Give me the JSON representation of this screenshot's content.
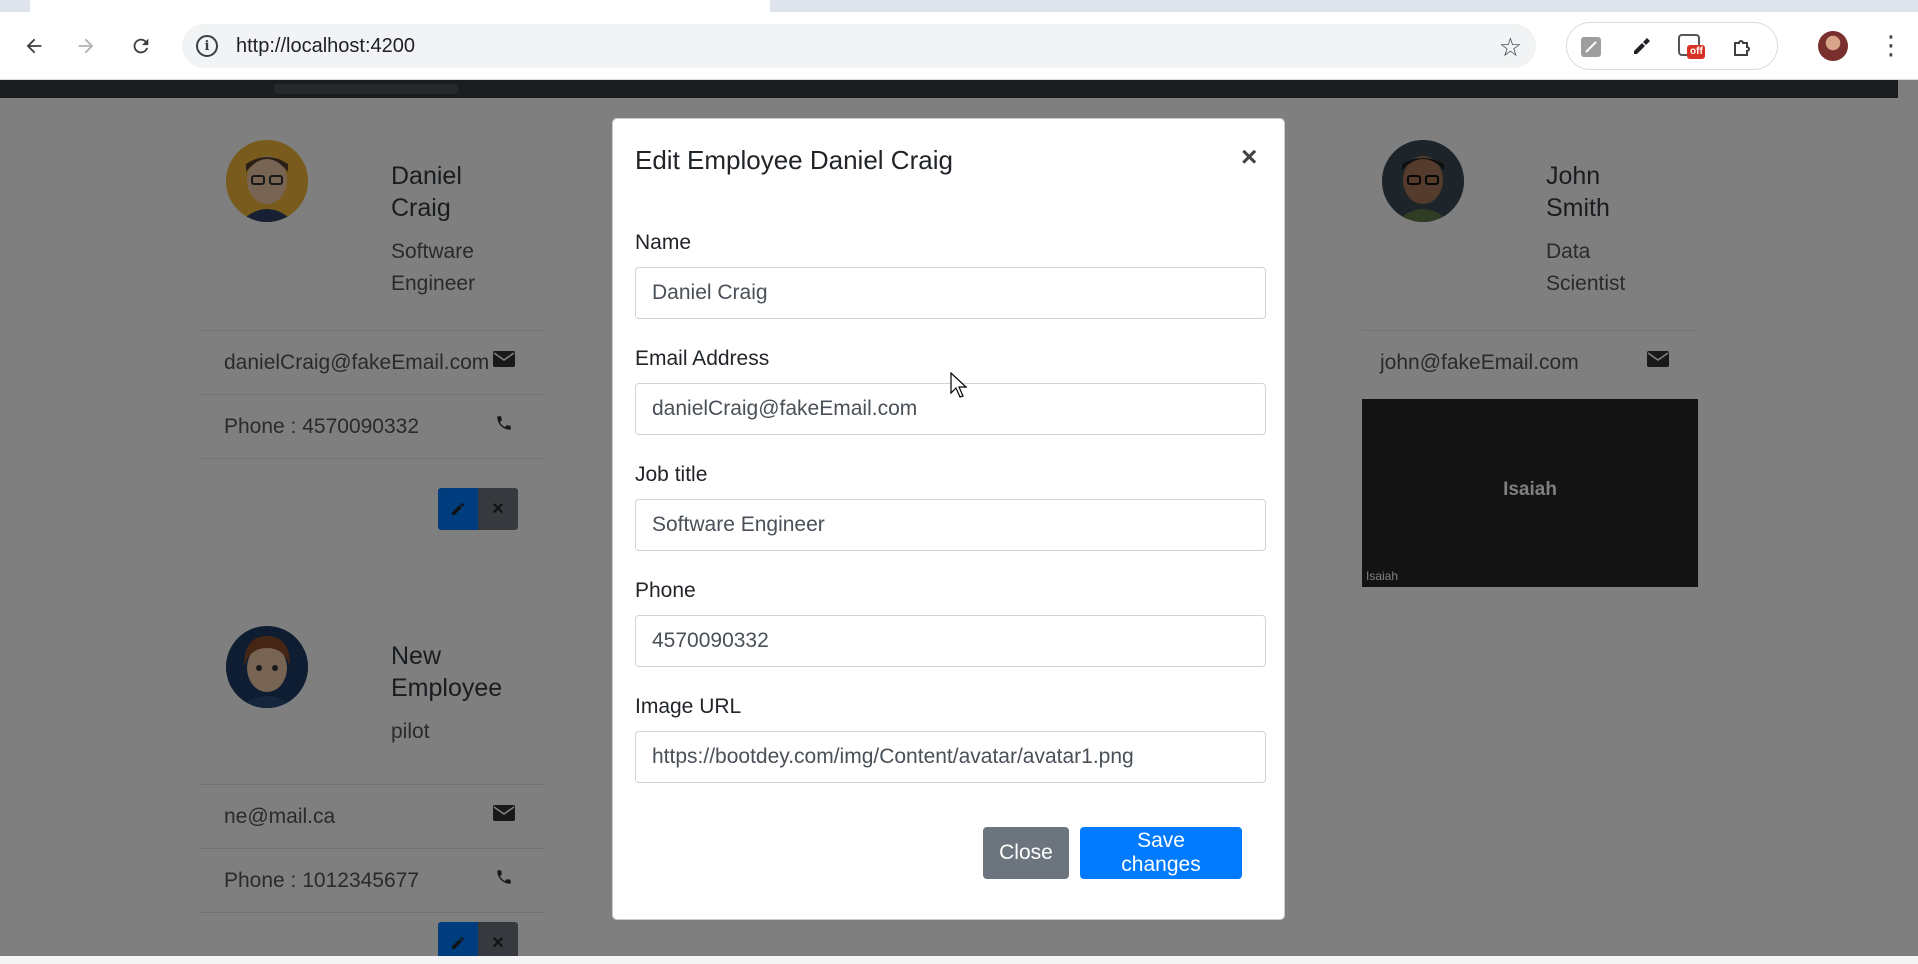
{
  "browser": {
    "url": "http://localhost:4200",
    "ext_badge": "off"
  },
  "employees": [
    {
      "name_line1": "Daniel",
      "name_line2": "Craig",
      "title_line1": "Software",
      "title_line2": "Engineer",
      "email": "danielCraig@fakeEmail.com",
      "phone": "Phone : 4570090332"
    },
    {
      "name_line1": "John",
      "name_line2": "Smith",
      "title_line1": "Data",
      "title_line2": "Scientist",
      "email": "john@fakeEmail.com"
    },
    {
      "name_line1": "New",
      "name_line2": "Employee",
      "title_line1": "pilot",
      "email": "ne@mail.ca",
      "phone": "Phone : 1012345677"
    }
  ],
  "video_tile": {
    "display_name": "Isaiah",
    "caption": "Isaiah"
  },
  "modal": {
    "title": "Edit Employee Daniel Craig",
    "close_glyph": "×",
    "fields": {
      "name": {
        "label": "Name",
        "value": "Daniel Craig"
      },
      "email": {
        "label": "Email Address",
        "value": "danielCraig@fakeEmail.com"
      },
      "job_title": {
        "label": "Job title",
        "value": "Software Engineer"
      },
      "phone": {
        "label": "Phone",
        "value": "4570090332"
      },
      "image_url": {
        "label": "Image URL",
        "value": "https://bootdey.com/img/Content/avatar/avatar1.png"
      }
    },
    "close_button": "Close",
    "save_button": "Save changes"
  },
  "colors": {
    "primary": "#007bff",
    "secondary": "#6c757d",
    "navbar": "#343a40"
  }
}
